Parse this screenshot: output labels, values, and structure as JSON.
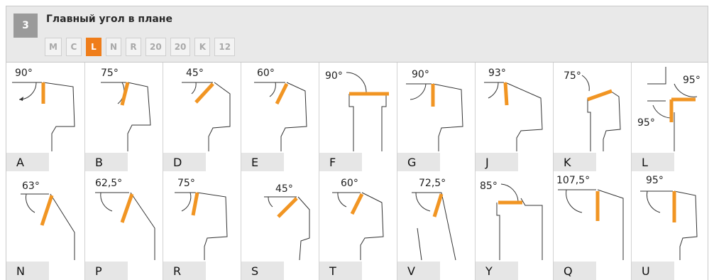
{
  "header": {
    "step": "3",
    "title": "Главный угол в плане",
    "chips": [
      "M",
      "C",
      "L",
      "N",
      "R",
      "20",
      "20",
      "K",
      "12"
    ],
    "active_index": 2,
    "accent_color": "#ef7d1a"
  },
  "row1": [
    {
      "letter": "A",
      "angle": "90°"
    },
    {
      "letter": "B",
      "angle": "75°"
    },
    {
      "letter": "D",
      "angle": "45°"
    },
    {
      "letter": "E",
      "angle": "60°"
    },
    {
      "letter": "F",
      "angle": "90°"
    },
    {
      "letter": "G",
      "angle": "90°"
    },
    {
      "letter": "J",
      "angle": "93°"
    },
    {
      "letter": "K",
      "angle": "75°"
    },
    {
      "letter": "L",
      "angle": "95°",
      "angle2": "95°"
    }
  ],
  "row2": [
    {
      "letter": "N",
      "angle": "63°"
    },
    {
      "letter": "P",
      "angle": "62,5°"
    },
    {
      "letter": "R",
      "angle": "75°"
    },
    {
      "letter": "S",
      "angle": "45°"
    },
    {
      "letter": "T",
      "angle": "60°"
    },
    {
      "letter": "V",
      "angle": "72,5°"
    },
    {
      "letter": "Y",
      "angle": "85°"
    },
    {
      "letter": "Q",
      "angle": "107,5°"
    },
    {
      "letter": "U",
      "angle": "95°"
    }
  ]
}
